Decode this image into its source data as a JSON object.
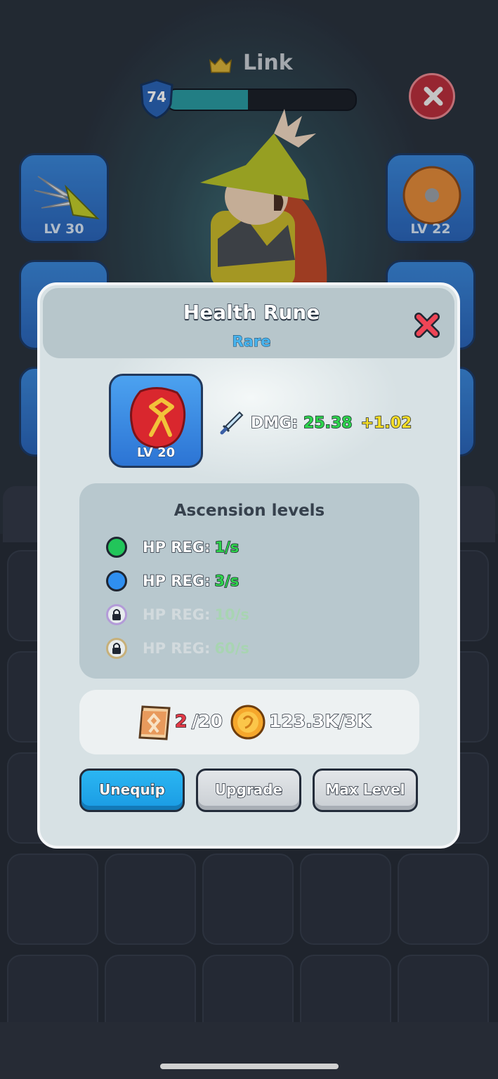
{
  "player": {
    "name": "Link",
    "level": "74",
    "xp_fraction": 0.43
  },
  "equip_slots": [
    {
      "level": "LV 30"
    },
    {
      "level": "LV 22"
    }
  ],
  "dialog": {
    "title": "Health Rune",
    "rarity": "Rare",
    "item_level": "LV 20",
    "stat": {
      "label": "DMG:",
      "value": "25.38",
      "bonus": "+1.02"
    },
    "ascension": {
      "title": "Ascension levels",
      "levels": [
        {
          "label": "HP REG:",
          "value": "1/s",
          "state": "unlocked",
          "color": "#22c55a"
        },
        {
          "label": "HP REG:",
          "value": "3/s",
          "state": "unlocked",
          "color": "#2f8ff0"
        },
        {
          "label": "HP REG:",
          "value": "10/s",
          "state": "locked",
          "lock_color": "#b39bd8"
        },
        {
          "label": "HP REG:",
          "value": "60/s",
          "state": "locked",
          "lock_color": "#c7b07a"
        }
      ]
    },
    "cost": {
      "scrolls_have": "2",
      "scrolls_need": "/20",
      "gold": "123.3K/3K"
    },
    "buttons": {
      "unequip": "Unequip",
      "upgrade": "Upgrade",
      "max_level": "Max Level"
    }
  },
  "colors": {
    "accent_blue": "#1a9be3",
    "close_red": "#e8404f",
    "rarity_blue": "#49b4ee"
  }
}
